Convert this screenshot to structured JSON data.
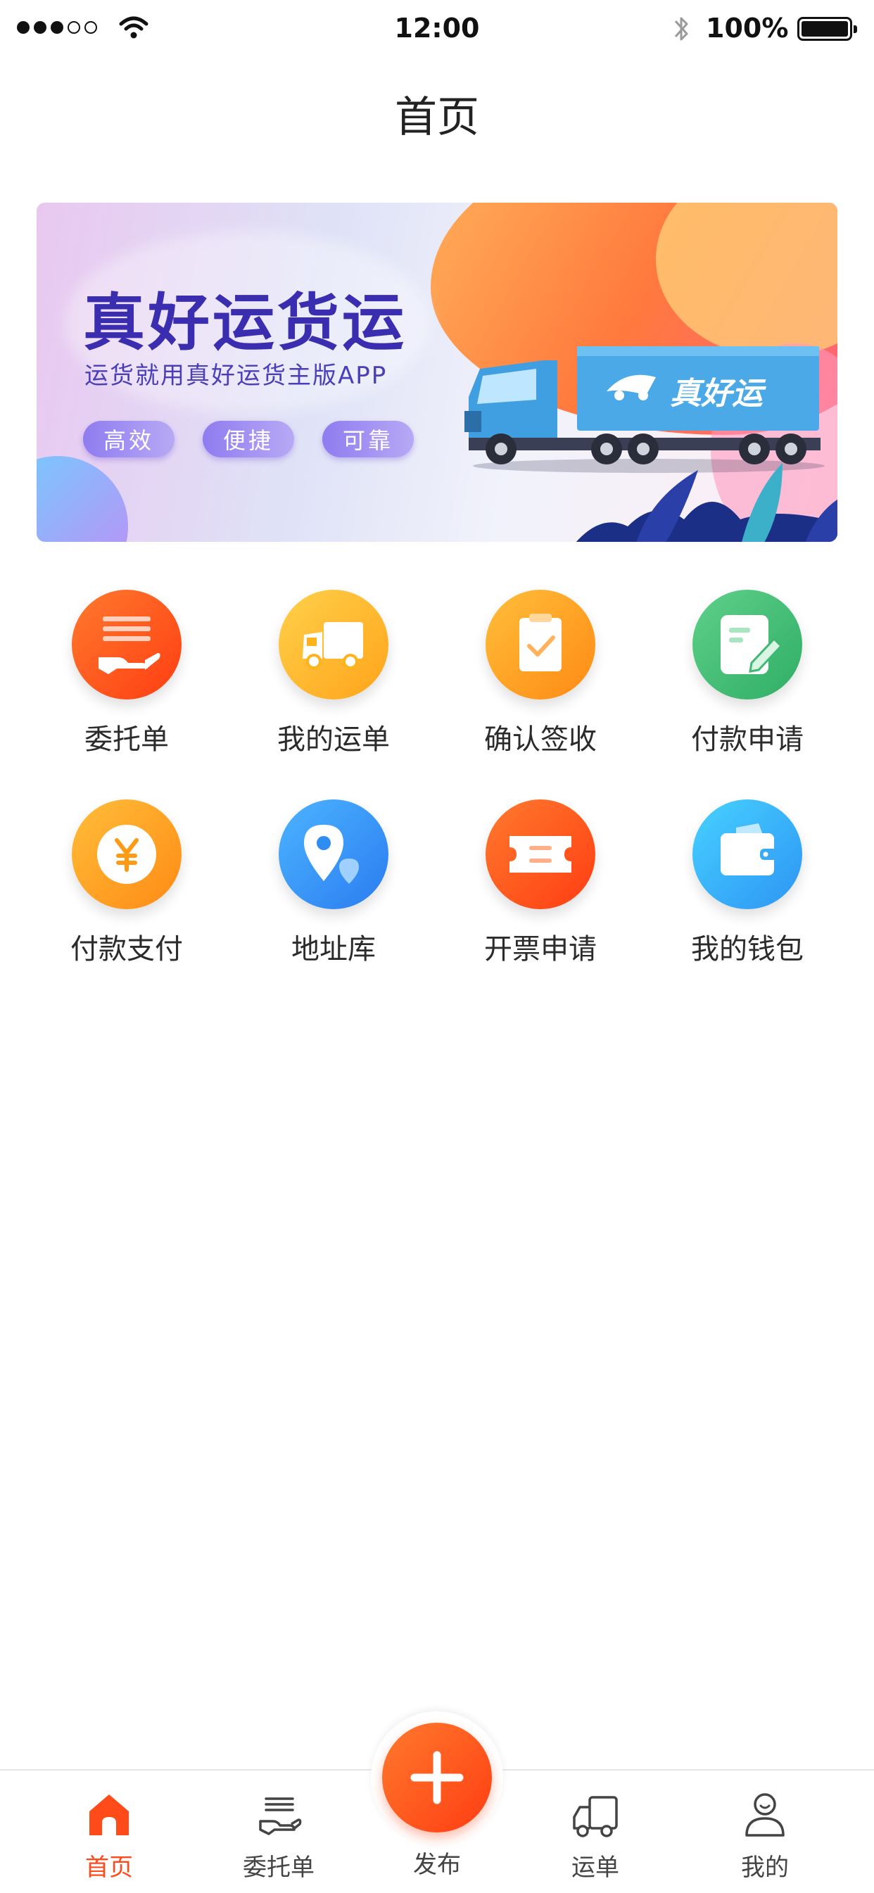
{
  "status_bar": {
    "time": "12:00",
    "battery": "100%"
  },
  "nav": {
    "title": "首页"
  },
  "banner": {
    "title": "真好运货运",
    "subtitle": "运货就用真好运货主版APP",
    "tags": [
      "高效",
      "便捷",
      "可靠"
    ],
    "truck_logo": "真好运"
  },
  "grid": [
    {
      "label": "委托单",
      "icon": "hand-document-icon",
      "color": "#ff4a1a"
    },
    {
      "label": "我的运单",
      "icon": "truck-icon",
      "color": "#ffb21a"
    },
    {
      "label": "确认签收",
      "icon": "clipboard-check-icon",
      "color": "#ff9a14"
    },
    {
      "label": "付款申请",
      "icon": "document-edit-icon",
      "color": "#3fb874"
    },
    {
      "label": "付款支付",
      "icon": "yuan-coin-icon",
      "color": "#ff9a14"
    },
    {
      "label": "地址库",
      "icon": "location-pin-icon",
      "color": "#2f8cf2"
    },
    {
      "label": "开票申请",
      "icon": "ticket-icon",
      "color": "#ff4a1a"
    },
    {
      "label": "我的钱包",
      "icon": "wallet-icon",
      "color": "#3aaaf6"
    }
  ],
  "tabbar": {
    "home": "首页",
    "orders": "委托单",
    "publish": "发布",
    "waybill": "运单",
    "mine": "我的",
    "active_color": "#ff4a1a"
  }
}
